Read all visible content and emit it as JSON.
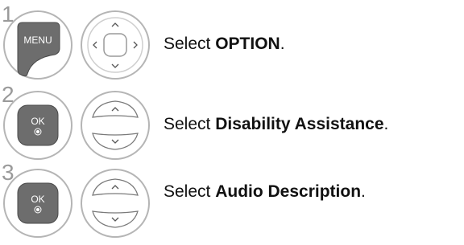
{
  "steps": [
    {
      "number": "1",
      "button_label": "MENU",
      "pad_type": "four-way",
      "instruction_prefix": "Select ",
      "instruction_bold": "OPTION",
      "instruction_suffix": "."
    },
    {
      "number": "2",
      "button_label": "OK",
      "pad_type": "up-down",
      "instruction_prefix": "Select ",
      "instruction_bold": "Disability Assistance",
      "instruction_suffix": "."
    },
    {
      "number": "3",
      "button_label": "OK",
      "pad_type": "up-down",
      "instruction_prefix": "Select ",
      "instruction_bold": "Audio Description",
      "instruction_suffix": "."
    }
  ],
  "icons": {
    "menu_button": "menu-button-icon",
    "ok_button": "ok-button-icon",
    "four_way_pad": "navigation-pad-icon",
    "up_down_pad": "up-down-buttons-icon"
  },
  "colors": {
    "button_fill": "#6d6d6d",
    "ring": "#b5b5b5",
    "step_number": "#9a9a9a",
    "text": "#111111"
  }
}
